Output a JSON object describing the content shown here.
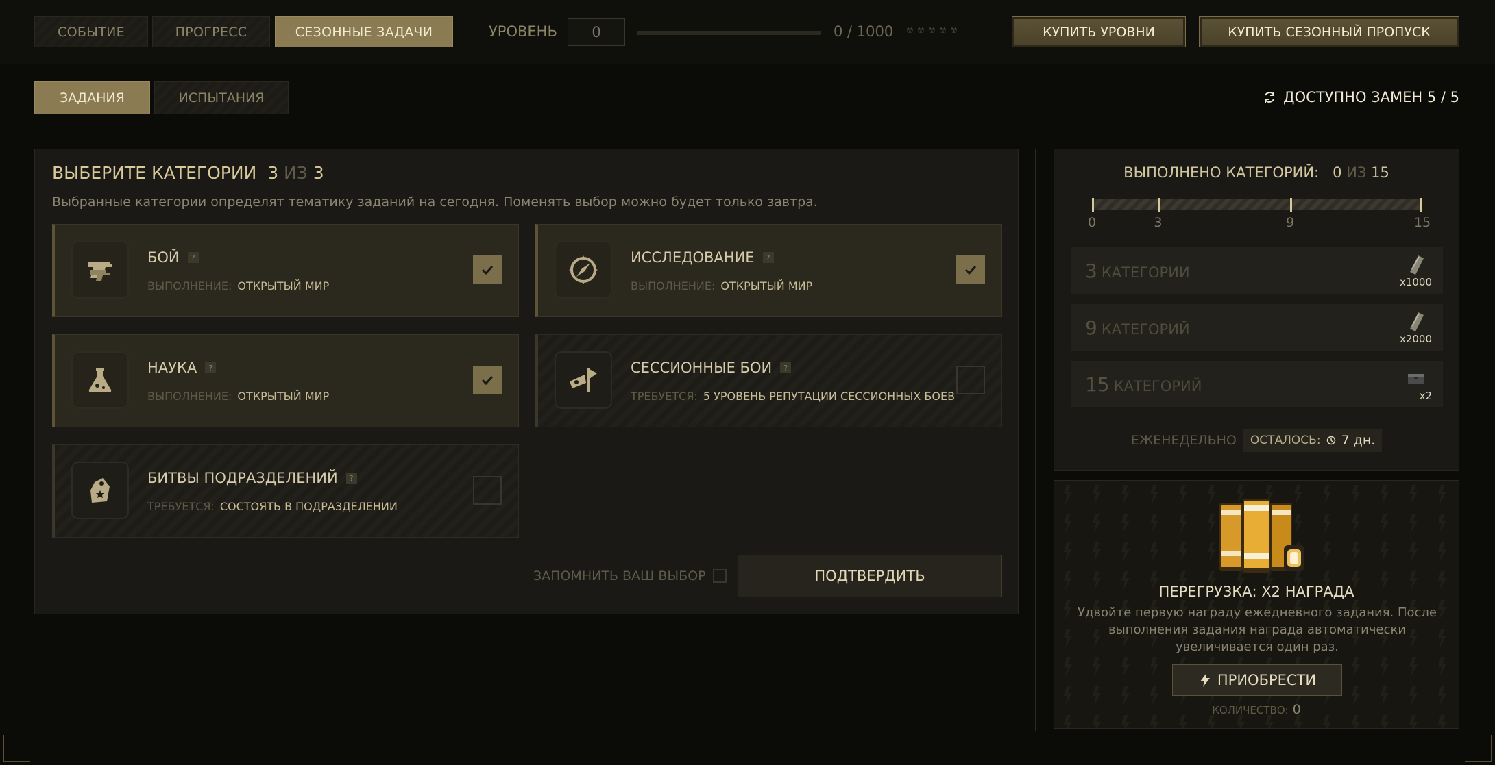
{
  "top_tabs": [
    {
      "label": "СОБЫТИЕ"
    },
    {
      "label": "ПРОГРЕСС"
    },
    {
      "label": "СЕЗОННЫЕ ЗАДАЧИ"
    }
  ],
  "level": {
    "label": "УРОВЕНЬ",
    "value": "0",
    "xp": "0 / 1000",
    "progress_fraction": 0
  },
  "buttons": {
    "buy_levels": "КУПИТЬ УРОВНИ",
    "buy_pass": "КУПИТЬ СЕЗОННЫЙ ПРОПУСК"
  },
  "sub_tabs": [
    {
      "label": "ЗАДАНИЯ"
    },
    {
      "label": "ИСПЫТАНИЯ"
    }
  ],
  "replacements": "ДОСТУПНО ЗАМЕН 5 / 5",
  "categories_panel": {
    "title": "ВЫБЕРИТЕ КАТЕГОРИИ",
    "count_selected": "3",
    "count_of": "ИЗ",
    "count_total": "3",
    "subtitle": "Выбранные категории определят тематику заданий на сегодня. Поменять выбор можно будет только завтра.",
    "categories": [
      {
        "name": "БОЙ",
        "req_label": "ВЫПОЛНЕНИЕ:",
        "req_value": "ОТКРЫТЫЙ МИР",
        "checked": true,
        "icon": "pistol-icon"
      },
      {
        "name": "ИССЛЕДОВАНИЕ",
        "req_label": "ВЫПОЛНЕНИЕ:",
        "req_value": "ОТКРЫТЫЙ МИР",
        "checked": true,
        "icon": "compass-icon"
      },
      {
        "name": "НАУКА",
        "req_label": "ВЫПОЛНЕНИЕ:",
        "req_value": "ОТКРЫТЫЙ МИР",
        "checked": true,
        "icon": "flask-icon"
      },
      {
        "name": "СЕССИОННЫЕ БОИ",
        "req_label": "ТРЕБУЕТСЯ:",
        "req_value": "5 УРОВЕНЬ РЕПУТАЦИИ СЕССИОННЫХ БОЕВ",
        "checked": false,
        "icon": "flag-icon"
      },
      {
        "name": "БИТВЫ ПОДРАЗДЕЛЕНИЙ",
        "req_label": "ТРЕБУЕТСЯ:",
        "req_value": "СОСТОЯТЬ В ПОДРАЗДЕЛЕНИИ",
        "checked": false,
        "icon": "squad-tag-icon"
      }
    ],
    "remember_label": "ЗАПОМНИТЬ ВАШ ВЫБОР",
    "confirm_label": "ПОДТВЕРДИТЬ"
  },
  "progress_panel": {
    "title": "ВЫПОЛНЕНО КАТЕГОРИЙ:",
    "done": "0",
    "of": "ИЗ",
    "total": "15",
    "ticks": [
      "0",
      "3",
      "9",
      "15"
    ],
    "tick_values": [
      0,
      3,
      9,
      15
    ],
    "rewards": [
      {
        "num": "3",
        "label": "КАТЕГОРИИ",
        "qty": "x1000",
        "icon": "ticket-icon"
      },
      {
        "num": "9",
        "label": "КАТЕГОРИЙ",
        "qty": "x2000",
        "icon": "ticket-icon"
      },
      {
        "num": "15",
        "label": "КАТЕГОРИЙ",
        "qty": "x2",
        "icon": "crate-icon"
      }
    ],
    "weekly_label": "ЕЖЕНЕДЕЛЬНО",
    "remain_label": "ОСТАЛОСЬ:",
    "remain_value": "7 дн."
  },
  "boost_panel": {
    "title": "ПЕРЕГРУЗКА: X2 НАГРАДА",
    "description": "Удвойте первую награду ежедневного задания. После выполнения задания награда автоматически увеличивается один раз.",
    "buy_label": "ПРИОБРЕСТИ",
    "count_label": "КОЛИЧЕСТВО:",
    "count_value": "0"
  }
}
